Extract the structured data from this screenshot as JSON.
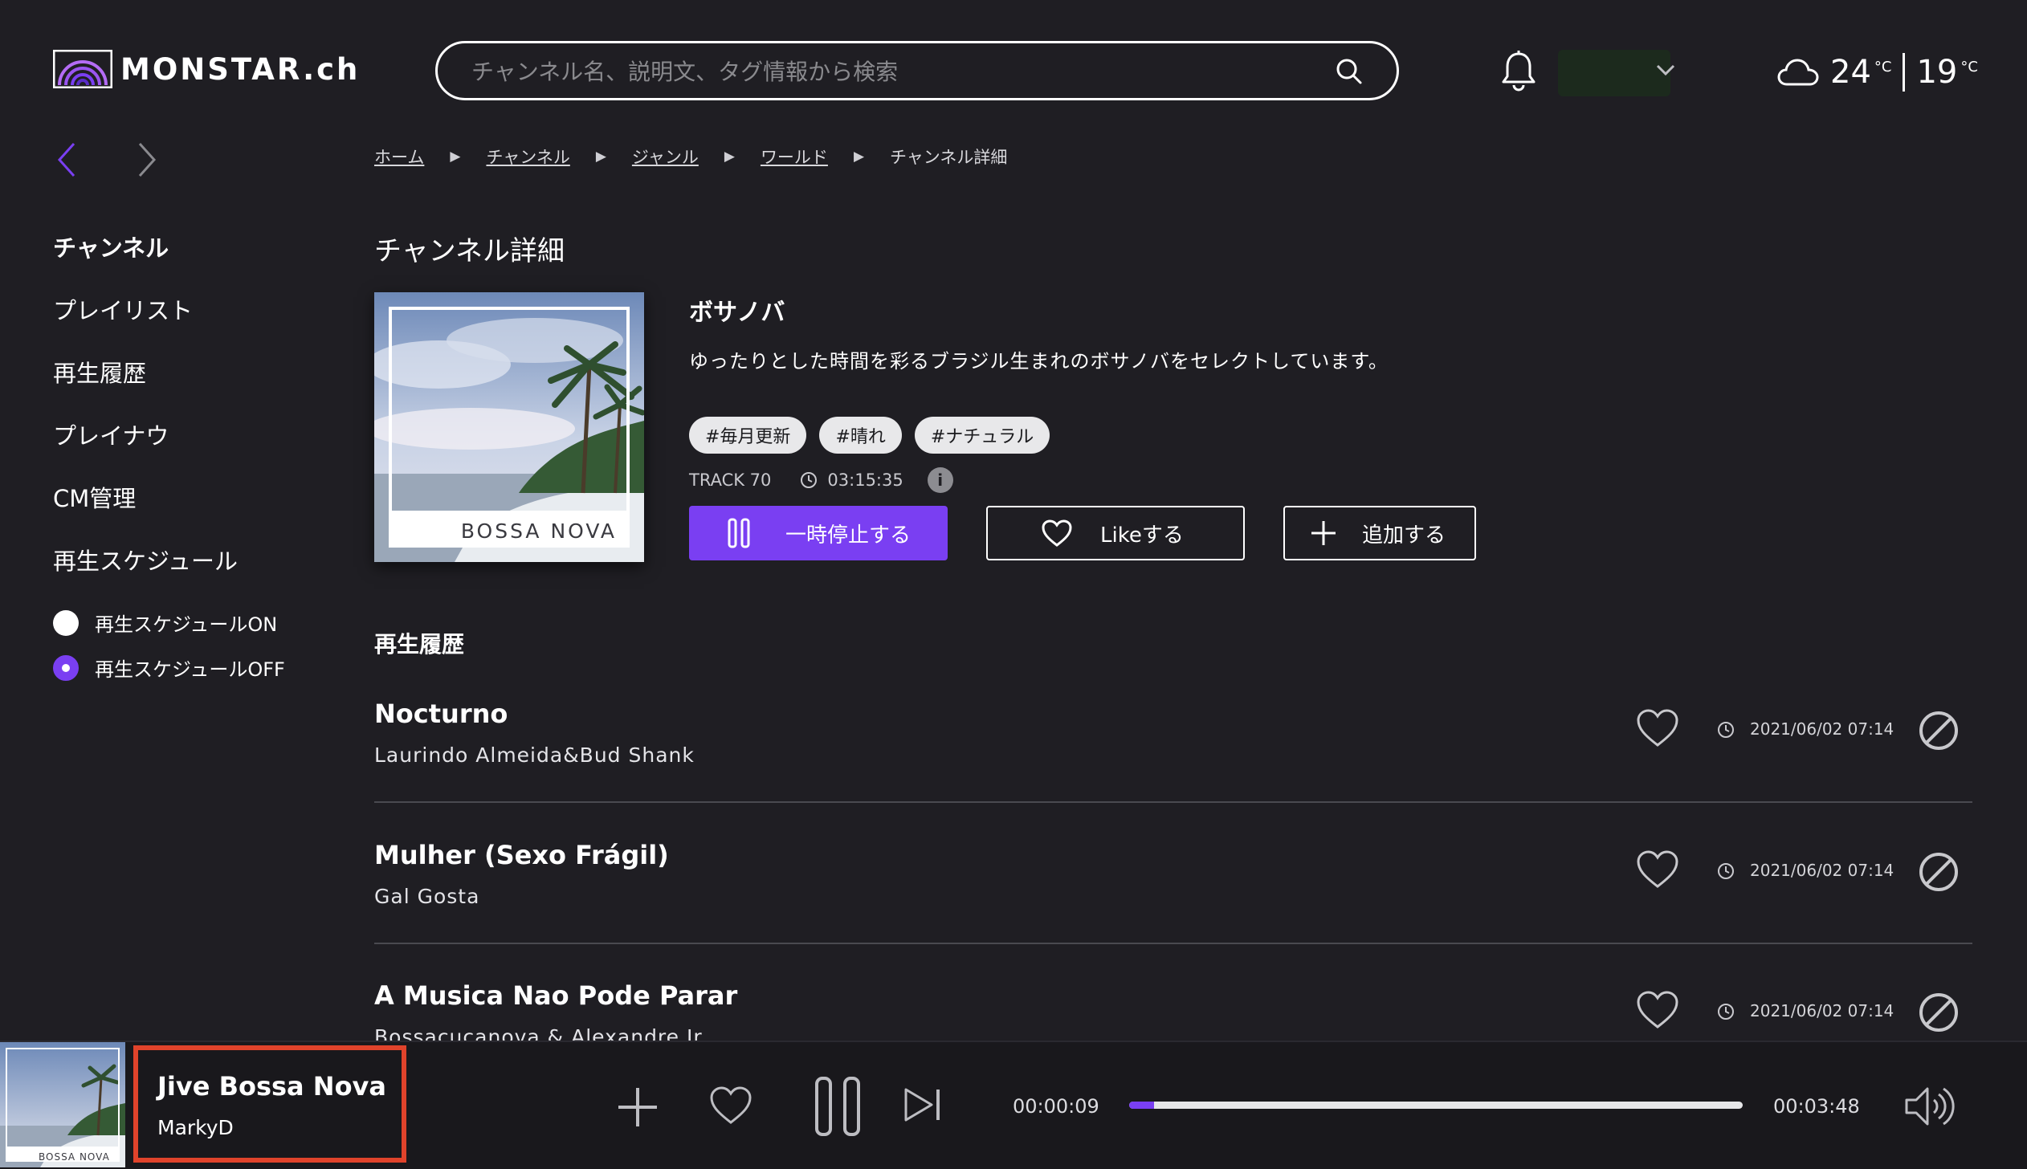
{
  "header": {
    "logo_text": "MONSTAR.ch",
    "search": {
      "placeholder": "チャンネル名、説明文、タグ情報から検索",
      "value": ""
    },
    "weather": {
      "icon": "cloud-icon",
      "high": "24",
      "low": "19",
      "unit": "°C"
    }
  },
  "breadcrumb": {
    "items": [
      "ホーム",
      "チャンネル",
      "ジャンル",
      "ワールド",
      "チャンネル詳細"
    ],
    "separator": "▶"
  },
  "sidebar": {
    "items": [
      "チャンネル",
      "プレイリスト",
      "再生履歴",
      "プレイナウ",
      "CM管理",
      "再生スケジュール"
    ],
    "active": "チャンネル",
    "schedule_options": [
      {
        "label": "再生スケジュールON",
        "selected": false
      },
      {
        "label": "再生スケジュールOFF",
        "selected": true
      }
    ]
  },
  "channel": {
    "page_title": "チャンネル詳細",
    "cover_label": "BOSSA NOVA",
    "name": "ボサノバ",
    "description": "ゆったりとした時間を彩るブラジル生まれのボサノバをセレクトしています。",
    "tags": [
      "#毎月更新",
      "#晴れ",
      "#ナチュラル"
    ],
    "track_count_label": "TRACK 70",
    "duration": "03:15:35",
    "info_icon_glyph": "i",
    "buttons": {
      "pause": "一時停止する",
      "like": "Likeする",
      "add": "追加する"
    }
  },
  "history": {
    "title": "再生履歴",
    "tracks": [
      {
        "title": "Nocturno",
        "artist": "Laurindo Almeida&Bud Shank",
        "played_at": "2021/06/02 07:14"
      },
      {
        "title": "Mulher (Sexo Frágil)",
        "artist": "Gal Gosta",
        "played_at": "2021/06/02 07:14"
      },
      {
        "title": "A Musica Nao Pode Parar",
        "artist": "Bossacucanova & Alexandre Jr",
        "played_at": "2021/06/02 07:14"
      }
    ]
  },
  "player": {
    "thumb_label": "BOSSA NOVA",
    "title": "Jive Bossa Nova",
    "artist": "MarkyD",
    "elapsed": "00:00:09",
    "total": "00:03:48",
    "progress": 0.04
  },
  "colors": {
    "background": "#1f1e23",
    "accent": "#7a3ff2",
    "highlight_border": "#e0432b"
  }
}
